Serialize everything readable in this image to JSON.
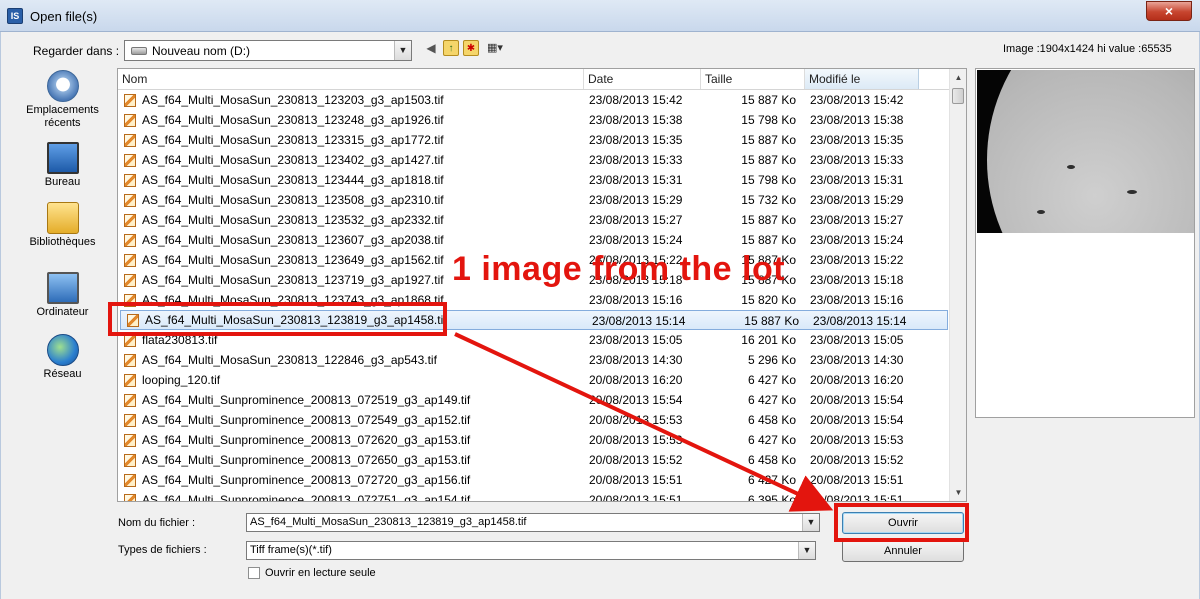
{
  "window": {
    "title": "Open file(s)",
    "close_glyph": "×"
  },
  "toolbar": {
    "look_in_label": "Regarder dans :",
    "look_in_value": "Nouveau nom (D:)",
    "icons": [
      "back-icon",
      "up-folder-icon",
      "new-folder-icon",
      "view-menu-icon"
    ]
  },
  "image_info": "Image :1904x1424 hi value :65535",
  "places": [
    {
      "label": "Emplacements\nrécents",
      "icon": "recent-places-icon"
    },
    {
      "label": "Bureau",
      "icon": "desktop-icon"
    },
    {
      "label": "Bibliothèques",
      "icon": "libraries-icon"
    },
    {
      "label": "Ordinateur",
      "icon": "computer-icon"
    },
    {
      "label": "Réseau",
      "icon": "network-icon"
    }
  ],
  "columns": {
    "name": "Nom",
    "date": "Date",
    "size": "Taille",
    "modified": "Modifié le"
  },
  "files": [
    {
      "name": "AS_f64_Multi_MosaSun_230813_123203_g3_ap1503.tif",
      "date": "23/08/2013 15:42",
      "size": "15 887 Ko",
      "modified": "23/08/2013 15:42"
    },
    {
      "name": "AS_f64_Multi_MosaSun_230813_123248_g3_ap1926.tif",
      "date": "23/08/2013 15:38",
      "size": "15 798 Ko",
      "modified": "23/08/2013 15:38"
    },
    {
      "name": "AS_f64_Multi_MosaSun_230813_123315_g3_ap1772.tif",
      "date": "23/08/2013 15:35",
      "size": "15 887 Ko",
      "modified": "23/08/2013 15:35"
    },
    {
      "name": "AS_f64_Multi_MosaSun_230813_123402_g3_ap1427.tif",
      "date": "23/08/2013 15:33",
      "size": "15 887 Ko",
      "modified": "23/08/2013 15:33"
    },
    {
      "name": "AS_f64_Multi_MosaSun_230813_123444_g3_ap1818.tif",
      "date": "23/08/2013 15:31",
      "size": "15 798 Ko",
      "modified": "23/08/2013 15:31"
    },
    {
      "name": "AS_f64_Multi_MosaSun_230813_123508_g3_ap2310.tif",
      "date": "23/08/2013 15:29",
      "size": "15 732 Ko",
      "modified": "23/08/2013 15:29"
    },
    {
      "name": "AS_f64_Multi_MosaSun_230813_123532_g3_ap2332.tif",
      "date": "23/08/2013 15:27",
      "size": "15 887 Ko",
      "modified": "23/08/2013 15:27"
    },
    {
      "name": "AS_f64_Multi_MosaSun_230813_123607_g3_ap2038.tif",
      "date": "23/08/2013 15:24",
      "size": "15 887 Ko",
      "modified": "23/08/2013 15:24"
    },
    {
      "name": "AS_f64_Multi_MosaSun_230813_123649_g3_ap1562.tif",
      "date": "23/08/2013 15:22",
      "size": "15 887 Ko",
      "modified": "23/08/2013 15:22"
    },
    {
      "name": "AS_f64_Multi_MosaSun_230813_123719_g3_ap1927.tif",
      "date": "23/08/2013 15:18",
      "size": "15 887 Ko",
      "modified": "23/08/2013 15:18"
    },
    {
      "name": "AS_f64_Multi_MosaSun_230813_123743_g3_ap1868.tif",
      "date": "23/08/2013 15:16",
      "size": "15 820 Ko",
      "modified": "23/08/2013 15:16"
    },
    {
      "name": "AS_f64_Multi_MosaSun_230813_123819_g3_ap1458.tif",
      "date": "23/08/2013 15:14",
      "size": "15 887 Ko",
      "modified": "23/08/2013 15:14",
      "selected": true
    },
    {
      "name": "flata230813.tif",
      "date": "23/08/2013 15:05",
      "size": "16 201 Ko",
      "modified": "23/08/2013 15:05"
    },
    {
      "name": "AS_f64_Multi_MosaSun_230813_122846_g3_ap543.tif",
      "date": "23/08/2013 14:30",
      "size": "5 296 Ko",
      "modified": "23/08/2013 14:30"
    },
    {
      "name": "looping_120.tif",
      "date": "20/08/2013 16:20",
      "size": "6 427 Ko",
      "modified": "20/08/2013 16:20"
    },
    {
      "name": "AS_f64_Multi_Sunprominence_200813_072519_g3_ap149.tif",
      "date": "20/08/2013 15:54",
      "size": "6 427 Ko",
      "modified": "20/08/2013 15:54"
    },
    {
      "name": "AS_f64_Multi_Sunprominence_200813_072549_g3_ap152.tif",
      "date": "20/08/2013 15:53",
      "size": "6 458 Ko",
      "modified": "20/08/2013 15:54"
    },
    {
      "name": "AS_f64_Multi_Sunprominence_200813_072620_g3_ap153.tif",
      "date": "20/08/2013 15:53",
      "size": "6 427 Ko",
      "modified": "20/08/2013 15:53"
    },
    {
      "name": "AS_f64_Multi_Sunprominence_200813_072650_g3_ap153.tif",
      "date": "20/08/2013 15:52",
      "size": "6 458 Ko",
      "modified": "20/08/2013 15:52"
    },
    {
      "name": "AS_f64_Multi_Sunprominence_200813_072720_g3_ap156.tif",
      "date": "20/08/2013 15:51",
      "size": "6 427 Ko",
      "modified": "20/08/2013 15:51"
    },
    {
      "name": "AS_f64_Multi_Sunprominence_200813_072751_g3_ap154.tif",
      "date": "20/08/2013 15:51",
      "size": "6 395 Ko",
      "modified": "20/08/2013 15:51"
    }
  ],
  "bottom": {
    "filename_label": "Nom du fichier :",
    "filename_value": "AS_f64_Multi_MosaSun_230813_123819_g3_ap1458.tif",
    "filetype_label": "Types de fichiers :",
    "filetype_value": "Tiff frame(s)(*.tif)",
    "readonly_label": "Ouvrir en lecture seule",
    "readonly_checked": false,
    "open_button": "Ouvrir",
    "cancel_button": "Annuler"
  },
  "annotation": {
    "text": "1 image from the lot",
    "color": "#e3150e"
  }
}
